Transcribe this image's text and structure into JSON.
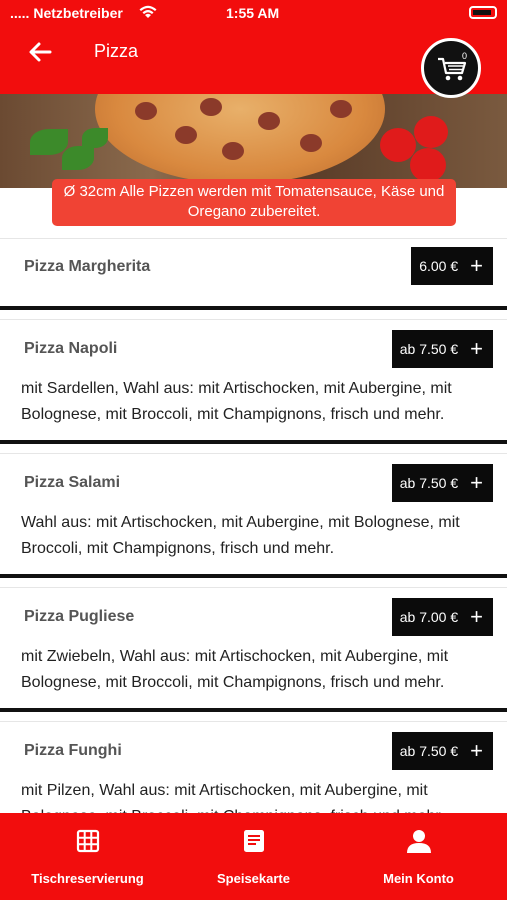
{
  "status_bar": {
    "carrier": "..... Netzbetreiber",
    "time": "1:55 AM"
  },
  "header": {
    "title": "Pizza",
    "cart_count": "0"
  },
  "info_banner": "Ø 32cm Alle Pizzen werden mit Tomatensauce, Käse und Oregano zubereitet.",
  "items": [
    {
      "name": "Pizza Margherita",
      "price": "6.00 €",
      "description": ""
    },
    {
      "name": "Pizza Napoli",
      "price": "ab 7.50 €",
      "description": "mit Sardellen, Wahl aus: mit Artischocken, mit Aubergine, mit Bolognese, mit Broccoli, mit Champignons, frisch und mehr."
    },
    {
      "name": "Pizza Salami",
      "price": "ab 7.50 €",
      "description": "Wahl aus: mit Artischocken, mit Aubergine, mit Bolognese, mit Broccoli, mit Champignons, frisch und mehr."
    },
    {
      "name": "Pizza Pugliese",
      "price": "ab 7.00 €",
      "description": "mit Zwiebeln, Wahl aus: mit Artischocken, mit Aubergine, mit Bolognese, mit Broccoli, mit Champignons, frisch und mehr."
    },
    {
      "name": "Pizza Funghi",
      "price": "ab 7.50 €",
      "description": "mit Pilzen,  Wahl aus: mit Artischocken, mit Aubergine, mit Bolognese, mit Broccoli, mit Champignons, frisch und mehr."
    }
  ],
  "bottom_nav": [
    {
      "label": "Tischreservierung",
      "icon": "grid-icon"
    },
    {
      "label": "Speisekarte",
      "icon": "menu-icon"
    },
    {
      "label": "Mein Konto",
      "icon": "user-icon"
    }
  ],
  "colors": {
    "primary": "#f20d0d",
    "banner": "#f04334",
    "price_bg": "#0b0b0b"
  }
}
